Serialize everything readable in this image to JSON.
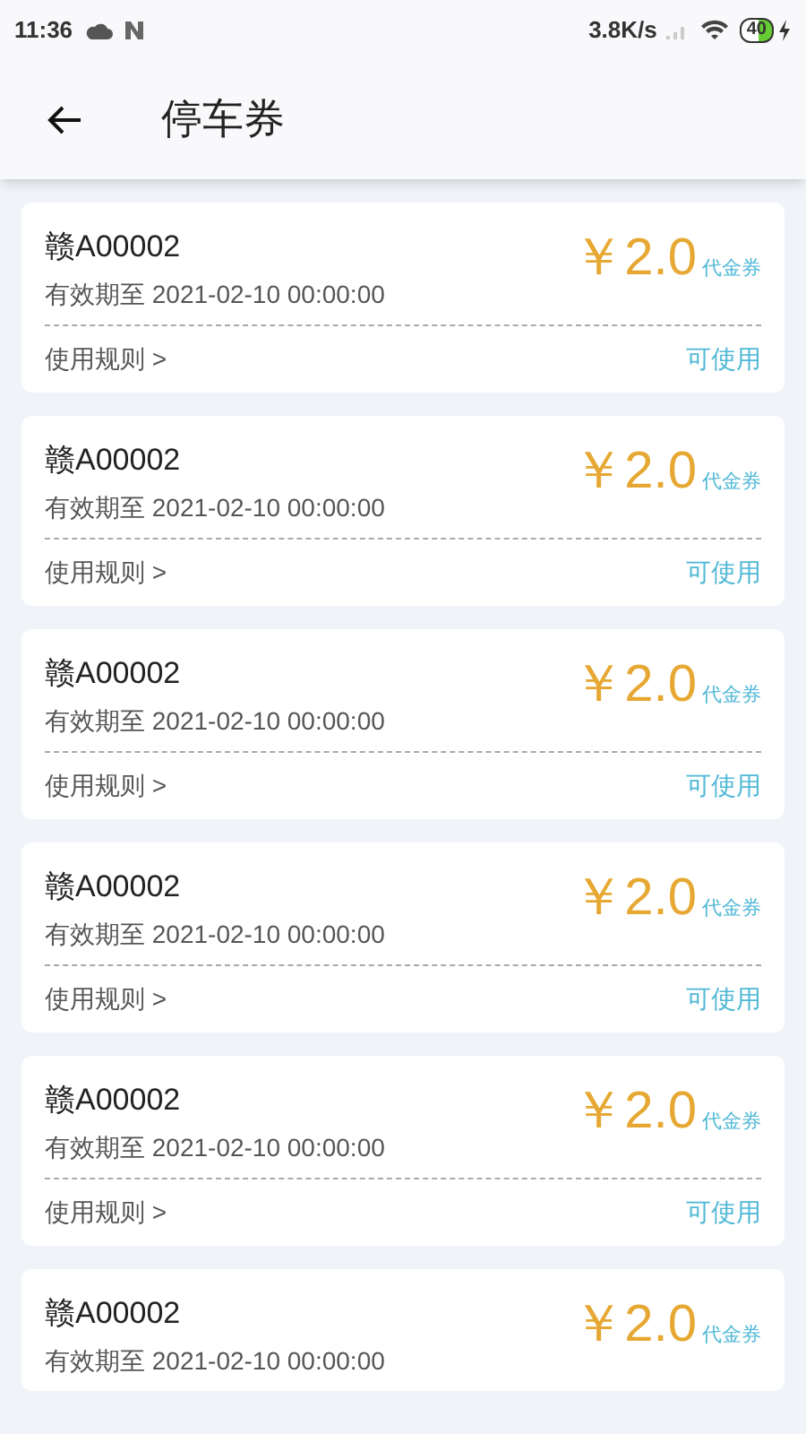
{
  "status_bar": {
    "time": "11:36",
    "speed": "3.8K/s",
    "battery": "40"
  },
  "header": {
    "title": "停车券"
  },
  "coupons": [
    {
      "plate": "赣A00002",
      "validity": "有效期至 2021-02-10 00:00:00",
      "amount": "￥2.0",
      "type": "代金券",
      "rule": "使用规则 >",
      "status": "可使用"
    },
    {
      "plate": "赣A00002",
      "validity": "有效期至 2021-02-10 00:00:00",
      "amount": "￥2.0",
      "type": "代金券",
      "rule": "使用规则 >",
      "status": "可使用"
    },
    {
      "plate": "赣A00002",
      "validity": "有效期至 2021-02-10 00:00:00",
      "amount": "￥2.0",
      "type": "代金券",
      "rule": "使用规则 >",
      "status": "可使用"
    },
    {
      "plate": "赣A00002",
      "validity": "有效期至 2021-02-10 00:00:00",
      "amount": "￥2.0",
      "type": "代金券",
      "rule": "使用规则 >",
      "status": "可使用"
    },
    {
      "plate": "赣A00002",
      "validity": "有效期至 2021-02-10 00:00:00",
      "amount": "￥2.0",
      "type": "代金券",
      "rule": "使用规则 >",
      "status": "可使用"
    },
    {
      "plate": "赣A00002",
      "validity": "有效期至 2021-02-10 00:00:00",
      "amount": "￥2.0",
      "type": "代金券"
    }
  ]
}
